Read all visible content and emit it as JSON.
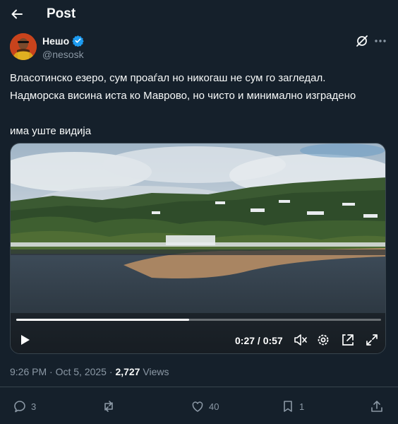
{
  "header": {
    "title": "Post"
  },
  "author": {
    "name": "Нешо",
    "handle": "@nesosk",
    "verified": true
  },
  "tweet": {
    "lines": [
      "Власотинско езеро, сум проаѓал но никогаш не сум го загледал.",
      "Надморска висина иста ко Маврово, но чисто и минимално изградено",
      "има уште видија"
    ]
  },
  "video": {
    "current_time": "0:27",
    "duration": "0:57",
    "time_label": "0:27 / 0:57",
    "progress_fraction": 0.4737
  },
  "meta": {
    "time": "9:26 PM",
    "separator": "·",
    "date": "Oct 5, 2025",
    "views_count": "2,727",
    "views_label": "Views"
  },
  "actions": {
    "replies": "3",
    "reposts": "",
    "likes": "40",
    "bookmarks": "1"
  },
  "colors": {
    "background": "#15202b",
    "text": "#f7f9f9",
    "muted": "#8b98a5",
    "verified": "#1d9bf0",
    "border": "#38444d"
  },
  "icons": [
    "back-arrow-icon",
    "verified-badge-icon",
    "grok-icon",
    "more-icon",
    "play-icon",
    "mute-icon",
    "settings-icon",
    "pip-icon",
    "fullscreen-icon",
    "reply-icon",
    "repost-icon",
    "like-icon",
    "bookmark-icon",
    "share-icon"
  ]
}
